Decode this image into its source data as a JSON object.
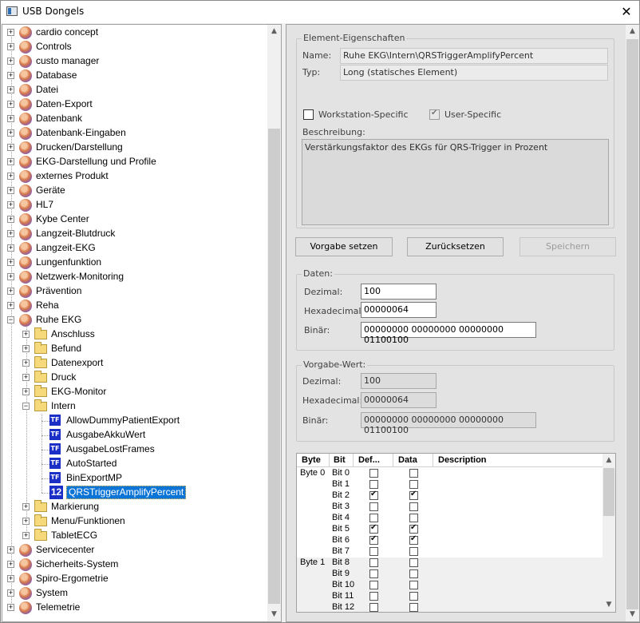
{
  "window": {
    "title": "USB Dongels",
    "close_glyph": "✕"
  },
  "tree": {
    "top_items": [
      "cardio concept",
      "Controls",
      "custo manager",
      "Database",
      "Datei",
      "Daten-Export",
      "Datenbank",
      "Datenbank-Eingaben",
      "Drucken/Darstellung",
      "EKG-Darstellung und Profile",
      "externes Produkt",
      "Geräte",
      "HL7",
      "Kybe Center",
      "Langzeit-Blutdruck",
      "Langzeit-EKG",
      "Lungenfunktion",
      "Netzwerk-Monitoring",
      "Prävention",
      "Reha"
    ],
    "expanded_item": "Ruhe EKG",
    "sub_folders_before": [
      "Anschluss",
      "Befund",
      "Datenexport",
      "Druck",
      "EKG-Monitor"
    ],
    "open_folder": "Intern",
    "intern_items": [
      {
        "label": "AllowDummyPatientExport",
        "icon": "TF"
      },
      {
        "label": "AusgabeAkkuWert",
        "icon": "TF"
      },
      {
        "label": "AusgabeLostFrames",
        "icon": "TF"
      },
      {
        "label": "AutoStarted",
        "icon": "TF"
      },
      {
        "label": "BinExportMP",
        "icon": "TF"
      },
      {
        "label": "QRSTriggerAmplifyPercent",
        "icon": "12",
        "selected": true
      }
    ],
    "sub_folders_after": [
      "Markierung",
      "Menu/Funktionen",
      "TabletECG"
    ],
    "bottom_items": [
      "Servicecenter",
      "Sicherheits-System",
      "Spiro-Ergometrie",
      "System",
      "Telemetrie"
    ]
  },
  "props": {
    "group_title": "Element-Eigenschaften",
    "name_label": "Name:",
    "name_value": "Ruhe EKG\\Intern\\QRSTriggerAmplifyPercent",
    "type_label": "Typ:",
    "type_value": "Long (statisches Element)",
    "workstation_label": "Workstation-Specific",
    "workstation_checked": false,
    "user_label": "User-Specific",
    "user_checked": true,
    "desc_label": "Beschreibung:",
    "desc_value": "Verstärkungsfaktor des EKGs für QRS-Trigger in Prozent"
  },
  "buttons": {
    "default_label": "Vorgabe setzen",
    "reset_label": "Zurücksetzen",
    "save_label": "Speichern"
  },
  "daten": {
    "group_title": "Daten:",
    "dec_label": "Dezimal:",
    "dec_value": "100",
    "hex_label": "Hexadecimal:",
    "hex_value": "00000064",
    "bin_label": "Binär:",
    "bin_value": "00000000 00000000 00000000 01100100"
  },
  "vorgabe": {
    "group_title": "Vorgabe-Wert:",
    "dec_label": "Dezimal:",
    "dec_value": "100",
    "hex_label": "Hexadecimal:",
    "hex_value": "00000064",
    "bin_label": "Binär:",
    "bin_value": "00000000 00000000 00000000 01100100"
  },
  "bitgrid": {
    "headers": [
      "Byte",
      "Bit",
      "Def...",
      "Data",
      "Description"
    ],
    "rows": [
      {
        "byte": "Byte 0",
        "bit": "Bit 0",
        "def": false,
        "data": false
      },
      {
        "byte": "",
        "bit": "Bit 1",
        "def": false,
        "data": false
      },
      {
        "byte": "",
        "bit": "Bit 2",
        "def": true,
        "data": true
      },
      {
        "byte": "",
        "bit": "Bit 3",
        "def": false,
        "data": false
      },
      {
        "byte": "",
        "bit": "Bit 4",
        "def": false,
        "data": false
      },
      {
        "byte": "",
        "bit": "Bit 5",
        "def": true,
        "data": true
      },
      {
        "byte": "",
        "bit": "Bit 6",
        "def": true,
        "data": true
      },
      {
        "byte": "",
        "bit": "Bit 7",
        "def": false,
        "data": false
      },
      {
        "byte": "Byte 1",
        "bit": "Bit 8",
        "def": false,
        "data": false
      },
      {
        "byte": "",
        "bit": "Bit 9",
        "def": false,
        "data": false
      },
      {
        "byte": "",
        "bit": "Bit 10",
        "def": false,
        "data": false
      },
      {
        "byte": "",
        "bit": "Bit 11",
        "def": false,
        "data": false
      },
      {
        "byte": "",
        "bit": "Bit 12",
        "def": false,
        "data": false
      }
    ]
  }
}
